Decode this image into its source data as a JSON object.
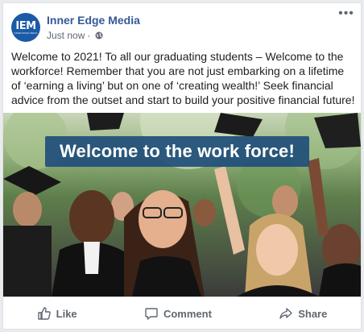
{
  "post": {
    "page_name": "Inner Edge Media",
    "timestamp": "Just now",
    "separator": "·",
    "privacy_icon": "globe-icon",
    "avatar_logo": "IEM",
    "avatar_tagline": "INNER EDGE MEDIA",
    "more_icon": "more-options-icon",
    "text": "Welcome to 2021! To all our graduating students – Welcome to the workforce! Remember that you are not just embarking on a lifetime of ‘earning a living’ but on one of ‘creating wealth!’ Seek financial advice from the outset and start to build your positive financial future!",
    "image_banner": "Welcome to the work force!"
  },
  "actions": {
    "like": "Like",
    "comment": "Comment",
    "share": "Share"
  },
  "colors": {
    "page_name": "#365899",
    "banner": "#1f4e79",
    "action_text": "#606770"
  }
}
